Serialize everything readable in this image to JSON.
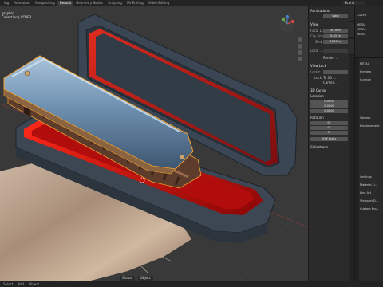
{
  "topbar": {
    "tabs": [
      "ing",
      "Animation",
      "Compositing",
      "Default",
      "Geometry Nodes",
      "Scripting",
      "UV Editing",
      "Video Editing"
    ],
    "active_tab": "Default",
    "scene_label": "Scene"
  },
  "viewport": {
    "line1": "graphic",
    "line2": "Collection | COVER",
    "toolbar": [
      "Global",
      "Object"
    ]
  },
  "npanel": {
    "annotations_label": "Annotations",
    "annotations_value": "View",
    "view_header": "View",
    "focal_label": "Focal L...",
    "focal_value": "50 mm",
    "clip_start_label": "Clip Start",
    "clip_start_value": "0.01 m",
    "clip_end_label": "End",
    "clip_end_value": "1000 m",
    "local_label": "Local ...",
    "render_label": "Render ...",
    "view_lock_header": "View Lock",
    "lock_object_label": "Lock t...",
    "lock_label": "Lock",
    "lock_to_3d": "To 3D ...",
    "lock_camera": "Camer...",
    "cursor_header": "3D Cursor",
    "location_label": "Location",
    "loc_x": "0.0000",
    "loc_y": "0.0000",
    "loc_z": "0.0000",
    "rotation_label": "Rotation",
    "rot_x": "0°",
    "rot_y": "0°",
    "rot_z": "0°",
    "rotation_mode": "XYZ Euler",
    "collections_header": "Collections"
  },
  "outliner": {
    "rows": [
      "COVER",
      "METAL",
      "METAL",
      "METAL"
    ]
  },
  "properties": {
    "rows": [
      "METAL",
      "Preview",
      "Surface",
      "Volume",
      "Displacement",
      "Settings",
      "Material Li...",
      "Line Art",
      "Viewport D...",
      "Custom Pro..."
    ]
  },
  "statusbar": {
    "items": [
      "Select",
      "Add",
      "Object"
    ]
  },
  "colors": {
    "viewport_bg": "#393939",
    "case_dark": "#3e4a55",
    "case_red": "#cc1010",
    "harmonica_blue": "#6d8fb0",
    "comb_brown": "#6e4a38",
    "cloth": "#b59c86",
    "selection_orange": "#f0a030"
  }
}
